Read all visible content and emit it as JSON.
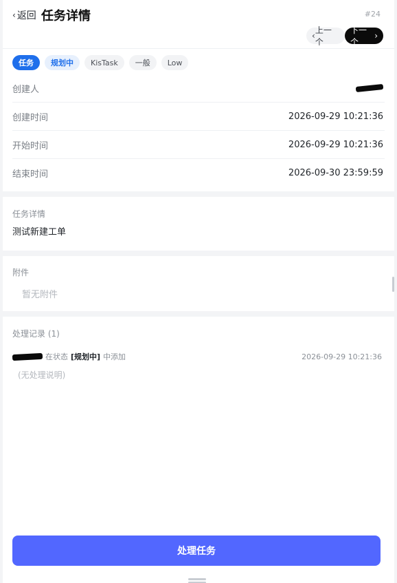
{
  "header": {
    "back_label": "返回",
    "title": "任务详情",
    "task_id": "#24",
    "prev_label": "上一个",
    "next_label": "下一个"
  },
  "tags": [
    "任务",
    "规划中",
    "KisTask",
    "一般",
    "Low"
  ],
  "info": {
    "creator_label": "创建人",
    "created_time_label": "创建时间",
    "created_time_value": "2026-09-29 10:21:36",
    "start_time_label": "开始时间",
    "start_time_value": "2026-09-29 10:21:36",
    "end_time_label": "结束时间",
    "end_time_value": "2026-09-30 23:59:59"
  },
  "detail": {
    "title": "任务详情",
    "text": "测试新建工单"
  },
  "attachment": {
    "title": "附件",
    "empty_text": "暂无附件"
  },
  "records": {
    "title": "处理记录",
    "count_text": "(1)",
    "items": [
      {
        "prefix": "在状态",
        "status": "[规划中]",
        "suffix": "中添加",
        "time": "2026-09-29 10:21:36",
        "note": "(无处理说明)"
      }
    ]
  },
  "action": {
    "label": "处理任务"
  },
  "colors": {
    "primary": "#1f6feb",
    "action": "#5267ff"
  },
  "icons": {
    "back": "chevron-left-icon",
    "prev": "chevron-left-icon",
    "next": "chevron-right-icon"
  }
}
